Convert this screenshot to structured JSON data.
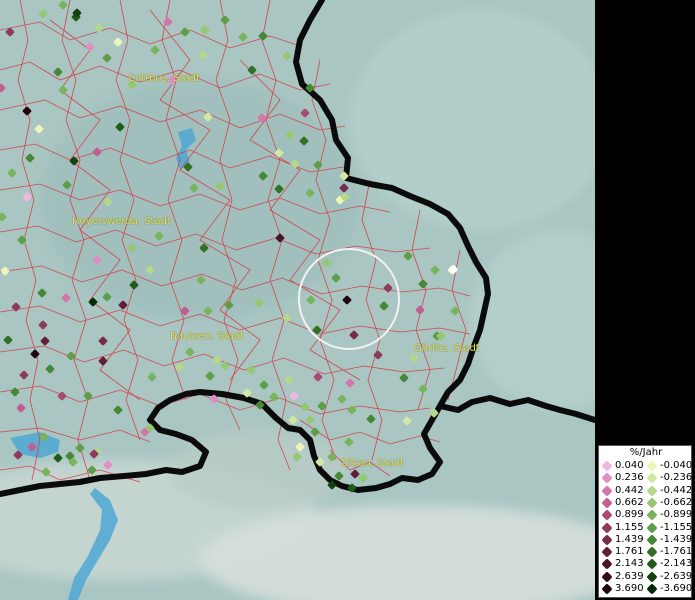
{
  "map": {
    "cities": [
      {
        "name": "Cottbus, Stadt"
      },
      {
        "name": "Hoyerswerda, Stadt"
      },
      {
        "name": "Bautzen, Stadt"
      },
      {
        "name": "Görlitz, Stadt"
      },
      {
        "name": "Zittau, Stadt"
      }
    ],
    "colors": {
      "terrain": "#a9c6c3",
      "district_lines": "#d8313a",
      "border": "#0b0b0b",
      "water": "#4fa7d4",
      "label": "#e8e84a",
      "highlight_circle": "#f2f2f2"
    }
  },
  "legend": {
    "title": "%/Jahr",
    "positive": [
      {
        "label": "0.040",
        "color": "#f2b7e0"
      },
      {
        "label": "0.236",
        "color": "#e08ec4"
      },
      {
        "label": "0.442",
        "color": "#d276ad"
      },
      {
        "label": "0.662",
        "color": "#c05f91"
      },
      {
        "label": "0.899",
        "color": "#a84a72"
      },
      {
        "label": "1.155",
        "color": "#8e3a5a"
      },
      {
        "label": "1.439",
        "color": "#762c48"
      },
      {
        "label": "1.761",
        "color": "#601f38"
      },
      {
        "label": "2.143",
        "color": "#4a1428"
      },
      {
        "label": "2.639",
        "color": "#350b1b"
      },
      {
        "label": "3.690",
        "color": "#1f0410"
      }
    ],
    "negative": [
      {
        "label": "-0.040",
        "color": "#eef5b8"
      },
      {
        "label": "-0.236",
        "color": "#d2e8a2"
      },
      {
        "label": "-0.442",
        "color": "#b3d88a"
      },
      {
        "label": "-0.662",
        "color": "#96c872"
      },
      {
        "label": "-0.899",
        "color": "#78b45c"
      },
      {
        "label": "-1.155",
        "color": "#5e9e48"
      },
      {
        "label": "-1.439",
        "color": "#478836"
      },
      {
        "label": "-1.761",
        "color": "#327126"
      },
      {
        "label": "-2.143",
        "color": "#215a19"
      },
      {
        "label": "-2.639",
        "color": "#13420e"
      },
      {
        "label": "-3.690",
        "color": "#062a05"
      }
    ]
  }
}
